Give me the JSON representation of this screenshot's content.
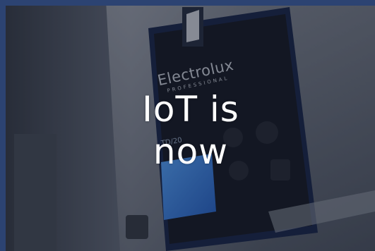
{
  "image": {
    "brand_logo": "electrolux-logo",
    "brand_name": "Electrolux",
    "brand_subtitle": "PROFESSIONAL",
    "model_label": "TD/20",
    "headline_line1": "IoT is",
    "headline_line2": "now",
    "colors": {
      "border": "#2c4372",
      "panel": "#1e2a4c",
      "display": "#3f8ff0",
      "text": "#ffffff"
    }
  }
}
